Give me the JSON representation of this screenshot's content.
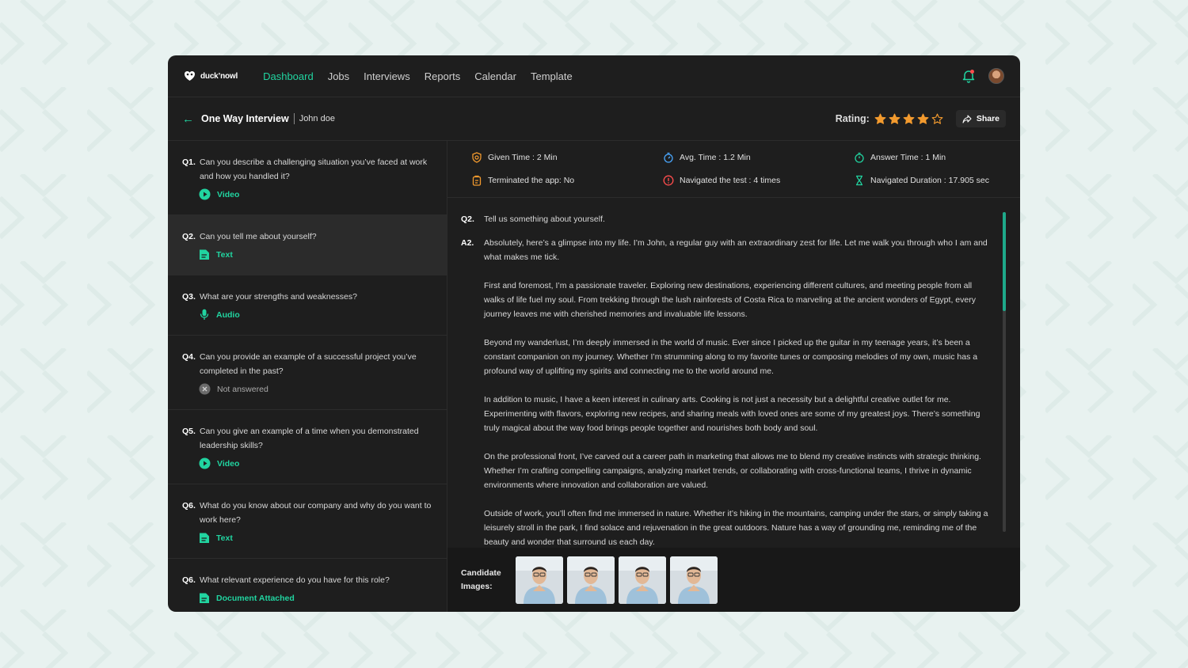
{
  "brand": {
    "logo_text": "duck’nowl"
  },
  "nav": {
    "items": [
      {
        "label": "Dashboard",
        "active": true
      },
      {
        "label": "Jobs",
        "active": false
      },
      {
        "label": "Interviews",
        "active": false
      },
      {
        "label": "Reports",
        "active": false
      },
      {
        "label": "Calendar",
        "active": false
      },
      {
        "label": "Template",
        "active": false
      }
    ]
  },
  "header": {
    "title": "One Way Interview",
    "candidate": "John doe",
    "rating_label": "Rating:",
    "rating_value": 4,
    "rating_max": 5,
    "share_label": "Share"
  },
  "questions": [
    {
      "num": "Q1.",
      "text": "Can you describe a challenging situation you’ve faced at work and how you handled it?",
      "type": "Video",
      "icon": "play-circle-icon",
      "active": false
    },
    {
      "num": "Q2.",
      "text": "Can you tell me about yourself?",
      "type": "Text",
      "icon": "document-icon",
      "active": true
    },
    {
      "num": "Q3.",
      "text": "What are your strengths and weaknesses?",
      "type": "Audio",
      "icon": "microphone-icon",
      "active": false
    },
    {
      "num": "Q4.",
      "text": "Can you provide an example of a successful project you’ve completed in the past?",
      "type": "Not answered",
      "icon": "close-circle-icon",
      "active": false
    },
    {
      "num": "Q5.",
      "text": "Can you give an example of a time when you demonstrated leadership skills?",
      "type": "Video",
      "icon": "play-circle-icon",
      "active": false
    },
    {
      "num": "Q6.",
      "text": "What do you know about our company and why do you want to work here?",
      "type": "Text",
      "icon": "document-icon",
      "active": false
    },
    {
      "num": "Q6.",
      "text": "What relevant experience do you have for this role?",
      "type": "Document Attached",
      "icon": "document-icon",
      "active": false
    }
  ],
  "stats": {
    "given_time": "Given Time : 2 Min",
    "avg_time": "Avg. Time : 1.2 Min",
    "answer_time": "Answer Time : 1 Min",
    "terminated": "Terminated the app: No",
    "navigated": "Navigated the test : 4 times",
    "navigated_duration": "Navigated Duration : 17.905 sec"
  },
  "answer": {
    "q_label": "Q2.",
    "question": "Tell us something about yourself.",
    "a_label": "A2.",
    "paragraphs": [
      "Absolutely, here’s a glimpse into my life. I’m John, a regular guy with an extraordinary zest for life. Let me walk you through who I am and what makes me tick.",
      "First and foremost, I’m a passionate traveler. Exploring new destinations, experiencing different cultures, and meeting people from all walks of life fuel my soul. From trekking through the lush rainforests of Costa Rica to marveling at the ancient wonders of Egypt, every journey leaves me with cherished memories and invaluable life lessons.",
      "Beyond my wanderlust, I’m deeply immersed in the world of music. Ever since I picked up the guitar in my teenage years, it’s been a constant companion on my journey. Whether I’m strumming along to my favorite tunes or composing melodies of my own, music has a profound way of uplifting my spirits and connecting me to the world around me.",
      "In addition to music, I have a keen interest in culinary arts. Cooking is not just a necessity but a delightful creative outlet for me. Experimenting with flavors, exploring new recipes, and sharing meals with loved ones are some of my greatest joys. There’s something truly magical about the way food brings people together and nourishes both body and soul.",
      "On the professional front, I’ve carved out a career path in marketing that allows me to blend my creative instincts with strategic thinking. Whether I’m crafting compelling campaigns, analyzing market trends, or collaborating with cross-functional teams, I thrive in dynamic environments where innovation and collaboration are valued.",
      "Outside of work, you’ll often find me immersed in nature. Whether it’s hiking in the mountains, camping under the stars, or simply taking a leisurely stroll in the park, I find solace and rejuvenation in the great outdoors. Nature has a way of grounding me, reminding me of the beauty and wonder that surround us each day."
    ],
    "scroll_fraction": 0.31
  },
  "candidate_images": {
    "label_line1": "Candidate",
    "label_line2": "Images:",
    "count": 4
  },
  "colors": {
    "accent": "#21d4a0",
    "star": "#f29a2e",
    "notification_dot": "#ff4d4d",
    "panel": "#1e1e1e"
  }
}
